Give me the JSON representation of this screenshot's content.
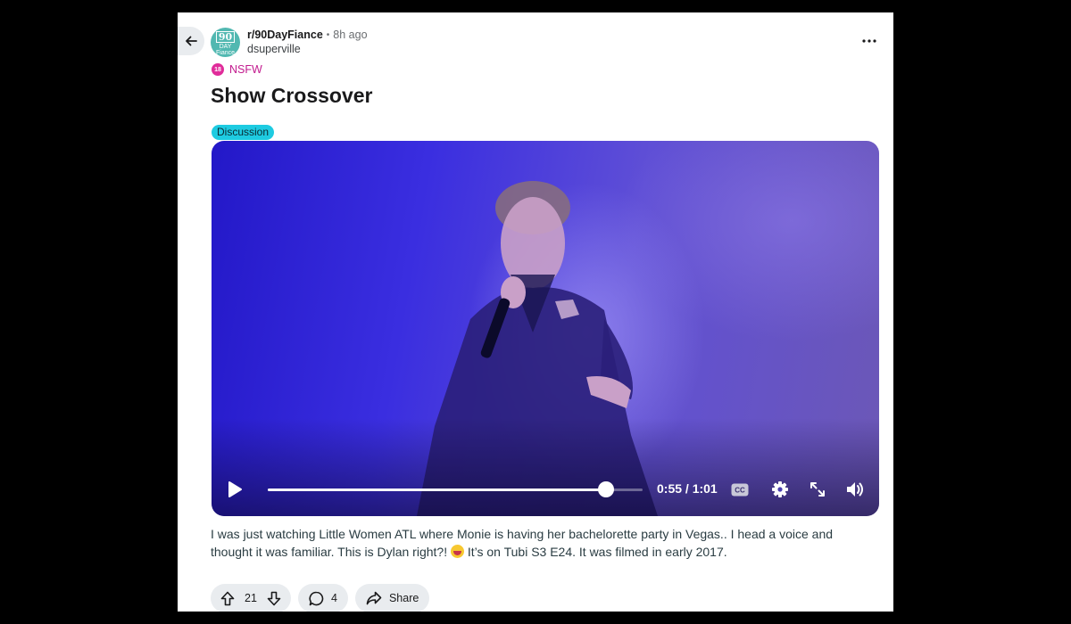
{
  "post": {
    "subreddit": "r/90DayFiance",
    "separator": "•",
    "time_ago": "8h ago",
    "author": "dsuperville",
    "nsfw_badge": "18",
    "nsfw_label": "NSFW",
    "title": "Show Crossover",
    "flair": "Discussion",
    "body_before_emoji": "I was just watching Little Women ATL where Monie is having her bachelorette party in Vegas.. I head a voice and thought it was familiar. This is Dylan right?! ",
    "body_after_emoji": " It’s on Tubi S3 E24. It was filmed in early 2017."
  },
  "avatar": {
    "line1": "90",
    "line2": "DAY",
    "line3": "Fiance",
    "color": "#51b8b1"
  },
  "video": {
    "time_display": "0:55 / 1:01",
    "progress_fraction": 0.902,
    "cc_label": "CC"
  },
  "actions": {
    "upvotes": "21",
    "comments": "4",
    "share_label": "Share"
  },
  "colors": {
    "nsfw": "#c21a8e",
    "flair_bg": "#1ecbe1",
    "pill_bg": "#e9ecef"
  },
  "icons": [
    "back-arrow-icon",
    "more-icon",
    "play-icon",
    "cc-icon",
    "settings-icon",
    "fullscreen-icon",
    "volume-icon",
    "upvote-icon",
    "downvote-icon",
    "comment-icon",
    "share-icon",
    "laughing-emoji-icon"
  ]
}
